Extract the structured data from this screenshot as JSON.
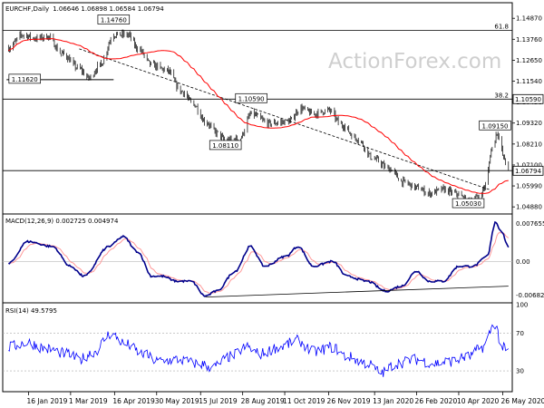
{
  "chart_data": [
    {
      "type": "candlestick",
      "title": "EURCHF,Daily",
      "ohlc_header": "1.06646 1.06898 1.06584 1.06794",
      "watermark": "ActionForex.com",
      "ylim": [
        1.046,
        1.156
      ],
      "y_ticks": [
        1.1487,
        1.1376,
        1.1265,
        1.1154,
        1.1043,
        1.0932,
        1.0821,
        1.071,
        1.0599,
        1.0488
      ],
      "current_price": "1.06794",
      "fib_labels": [
        {
          "label": "61.8",
          "value": 1.1423
        },
        {
          "label": "38.2",
          "value": 1.1059
        }
      ],
      "h_lines": [
        1.1423,
        1.1059,
        1.068
      ],
      "trendline": [
        {
          "x": "2019-03-10",
          "y": 1.1325
        },
        {
          "x": "2020-05-12",
          "y": 1.058
        }
      ],
      "short_hline": {
        "x1": "2018-12-24",
        "x2": "2019-04-15",
        "y": 1.1162
      },
      "annotations": [
        {
          "text": "1.14760",
          "x": "2019-04-15",
          "y": 1.1476
        },
        {
          "text": "1.11620",
          "x": "2019-01-12",
          "y": 1.1162
        },
        {
          "text": "1.10590",
          "x": "2019-09-06",
          "y": 1.1059
        },
        {
          "text": "1.08110",
          "x": "2019-08-10",
          "y": 1.0811
        },
        {
          "text": "1.09150",
          "x": "2020-05-18",
          "y": 1.0915
        },
        {
          "text": "1.05030",
          "x": "2020-04-20",
          "y": 1.0503
        }
      ],
      "ma_color": "#ff0000",
      "candle_color": "#000000",
      "price_keypoints": [
        [
          "2018-12-26",
          1.133
        ],
        [
          "2019-01-10",
          1.14
        ],
        [
          "2019-01-24",
          1.138
        ],
        [
          "2019-02-05",
          1.139
        ],
        [
          "2019-02-20",
          1.13
        ],
        [
          "2019-03-10",
          1.122
        ],
        [
          "2019-03-20",
          1.117
        ],
        [
          "2019-04-01",
          1.124
        ],
        [
          "2019-04-15",
          1.14
        ],
        [
          "2019-04-30",
          1.14
        ],
        [
          "2019-05-10",
          1.133
        ],
        [
          "2019-05-25",
          1.124
        ],
        [
          "2019-06-10",
          1.121
        ],
        [
          "2019-06-25",
          1.11
        ],
        [
          "2019-07-08",
          1.103
        ],
        [
          "2019-07-20",
          1.094
        ],
        [
          "2019-08-01",
          1.088
        ],
        [
          "2019-08-10",
          1.084
        ],
        [
          "2019-08-25",
          1.085
        ],
        [
          "2019-09-06",
          1.098
        ],
        [
          "2019-09-25",
          1.093
        ],
        [
          "2019-10-15",
          1.094
        ],
        [
          "2019-10-28",
          1.101
        ],
        [
          "2019-11-10",
          1.098
        ],
        [
          "2019-11-26",
          1.1
        ],
        [
          "2019-12-10",
          1.092
        ],
        [
          "2019-12-25",
          1.085
        ],
        [
          "2020-01-13",
          1.074
        ],
        [
          "2020-01-28",
          1.069
        ],
        [
          "2020-02-12",
          1.062
        ],
        [
          "2020-02-26",
          1.059
        ],
        [
          "2020-03-10",
          1.056
        ],
        [
          "2020-03-25",
          1.058
        ],
        [
          "2020-04-06",
          1.056
        ],
        [
          "2020-04-20",
          1.052
        ],
        [
          "2020-05-01",
          1.054
        ],
        [
          "2020-05-08",
          1.06
        ],
        [
          "2020-05-15",
          1.08
        ],
        [
          "2020-05-20",
          1.088
        ],
        [
          "2020-05-28",
          1.074
        ],
        [
          "2020-06-01",
          1.068
        ]
      ],
      "x_ticks": [
        "16 Jan 2019",
        "1 Mar 2019",
        "16 Apr 2019",
        "30 May 2019",
        "15 Jul 2019",
        "28 Aug 2019",
        "11 Oct 2019",
        "26 Nov 2019",
        "13 Jan 2020",
        "26 Feb 2020",
        "10 Apr 2020",
        "26 May 2020"
      ]
    },
    {
      "type": "line",
      "title": "MACD(12,26,9) 0.002725 0.004974",
      "ylim": [
        -0.008,
        0.0092
      ],
      "y_ticks": [
        {
          "label": "0.007655",
          "value": 0.007655
        },
        {
          "label": "0.00",
          "value": 0.0
        },
        {
          "label": "-0.006822",
          "value": -0.006822
        }
      ],
      "line_color": "#00008b",
      "signal_color": "#ff9999",
      "trendline": [
        {
          "x": "2019-07-20",
          "y": -0.0072
        },
        {
          "x": "2020-06-01",
          "y": -0.005
        }
      ],
      "macd_keypoints": [
        [
          "2018-12-26",
          -0.0005
        ],
        [
          "2019-01-15",
          0.004
        ],
        [
          "2019-02-10",
          0.003
        ],
        [
          "2019-03-01",
          -0.001
        ],
        [
          "2019-03-15",
          -0.003
        ],
        [
          "2019-04-10",
          0.003
        ],
        [
          "2019-04-25",
          0.005
        ],
        [
          "2019-05-10",
          0.002
        ],
        [
          "2019-05-25",
          -0.003
        ],
        [
          "2019-06-05",
          -0.003
        ],
        [
          "2019-06-20",
          -0.004
        ],
        [
          "2019-07-05",
          -0.004
        ],
        [
          "2019-07-20",
          -0.007
        ],
        [
          "2019-08-01",
          -0.006
        ],
        [
          "2019-08-20",
          -0.002
        ],
        [
          "2019-09-05",
          0.003
        ],
        [
          "2019-09-20",
          -0.001
        ],
        [
          "2019-10-12",
          0.001
        ],
        [
          "2019-10-25",
          0.003
        ],
        [
          "2019-11-10",
          -0.001
        ],
        [
          "2019-11-30",
          0.0
        ],
        [
          "2019-12-15",
          -0.003
        ],
        [
          "2020-01-05",
          -0.004
        ],
        [
          "2020-01-25",
          -0.006
        ],
        [
          "2020-02-10",
          -0.005
        ],
        [
          "2020-02-26",
          -0.002
        ],
        [
          "2020-03-10",
          -0.004
        ],
        [
          "2020-03-25",
          -0.004
        ],
        [
          "2020-04-10",
          -0.001
        ],
        [
          "2020-04-25",
          -0.001
        ],
        [
          "2020-05-10",
          0.001
        ],
        [
          "2020-05-18",
          0.008
        ],
        [
          "2020-05-25",
          0.006
        ],
        [
          "2020-06-01",
          0.0027
        ]
      ]
    },
    {
      "type": "line",
      "title": "RSI(14) 49.5795",
      "ylim": [
        10,
        100
      ],
      "y_ticks": [
        {
          "label": "100",
          "value": 100
        },
        {
          "label": "70",
          "value": 70
        },
        {
          "label": "30",
          "value": 30
        }
      ],
      "ref_lines": [
        70,
        30
      ],
      "line_color": "#0000ff",
      "rsi_keypoints": [
        [
          "2018-12-26",
          55
        ],
        [
          "2019-01-15",
          60
        ],
        [
          "2019-02-05",
          53
        ],
        [
          "2019-02-25",
          48
        ],
        [
          "2019-03-10",
          42
        ],
        [
          "2019-03-25",
          50
        ],
        [
          "2019-04-12",
          69
        ],
        [
          "2019-04-28",
          58
        ],
        [
          "2019-05-15",
          48
        ],
        [
          "2019-06-01",
          40
        ],
        [
          "2019-06-20",
          42
        ],
        [
          "2019-07-10",
          38
        ],
        [
          "2019-07-28",
          34
        ],
        [
          "2019-08-15",
          45
        ],
        [
          "2019-09-01",
          55
        ],
        [
          "2019-09-15",
          48
        ],
        [
          "2019-10-05",
          55
        ],
        [
          "2019-10-25",
          62
        ],
        [
          "2019-11-10",
          50
        ],
        [
          "2019-11-30",
          55
        ],
        [
          "2019-12-15",
          45
        ],
        [
          "2020-01-05",
          38
        ],
        [
          "2020-01-20",
          28
        ],
        [
          "2020-02-05",
          38
        ],
        [
          "2020-02-26",
          42
        ],
        [
          "2020-03-15",
          38
        ],
        [
          "2020-04-01",
          40
        ],
        [
          "2020-04-20",
          45
        ],
        [
          "2020-05-05",
          55
        ],
        [
          "2020-05-18",
          80
        ],
        [
          "2020-05-25",
          55
        ],
        [
          "2020-06-01",
          49.6
        ]
      ]
    }
  ]
}
